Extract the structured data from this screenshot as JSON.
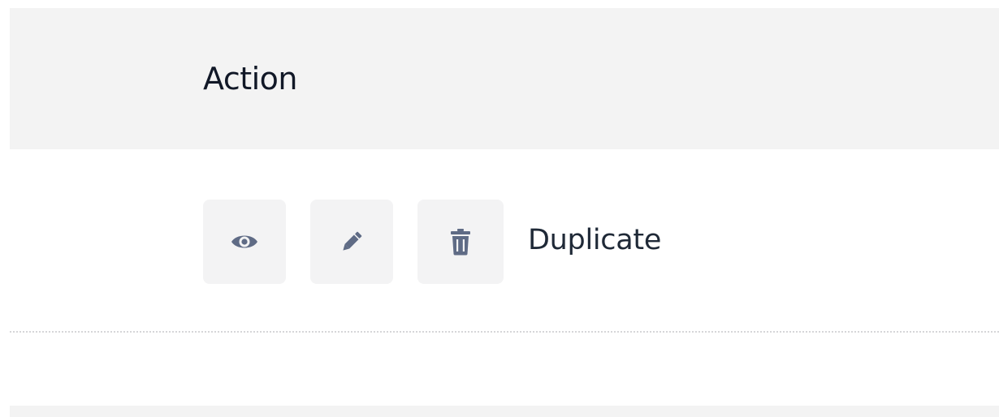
{
  "table": {
    "header": {
      "action_label": "Action"
    },
    "rows": [
      {
        "actions": {
          "view_icon": "eye-icon",
          "edit_icon": "pencil-icon",
          "delete_icon": "trash-icon",
          "duplicate_label": "Duplicate"
        }
      }
    ]
  },
  "colors": {
    "header_background": "#f3f3f3",
    "button_background": "#f3f3f4",
    "icon_color": "#5f6b85",
    "text_color": "#1f2937",
    "header_text_color": "#111827"
  }
}
